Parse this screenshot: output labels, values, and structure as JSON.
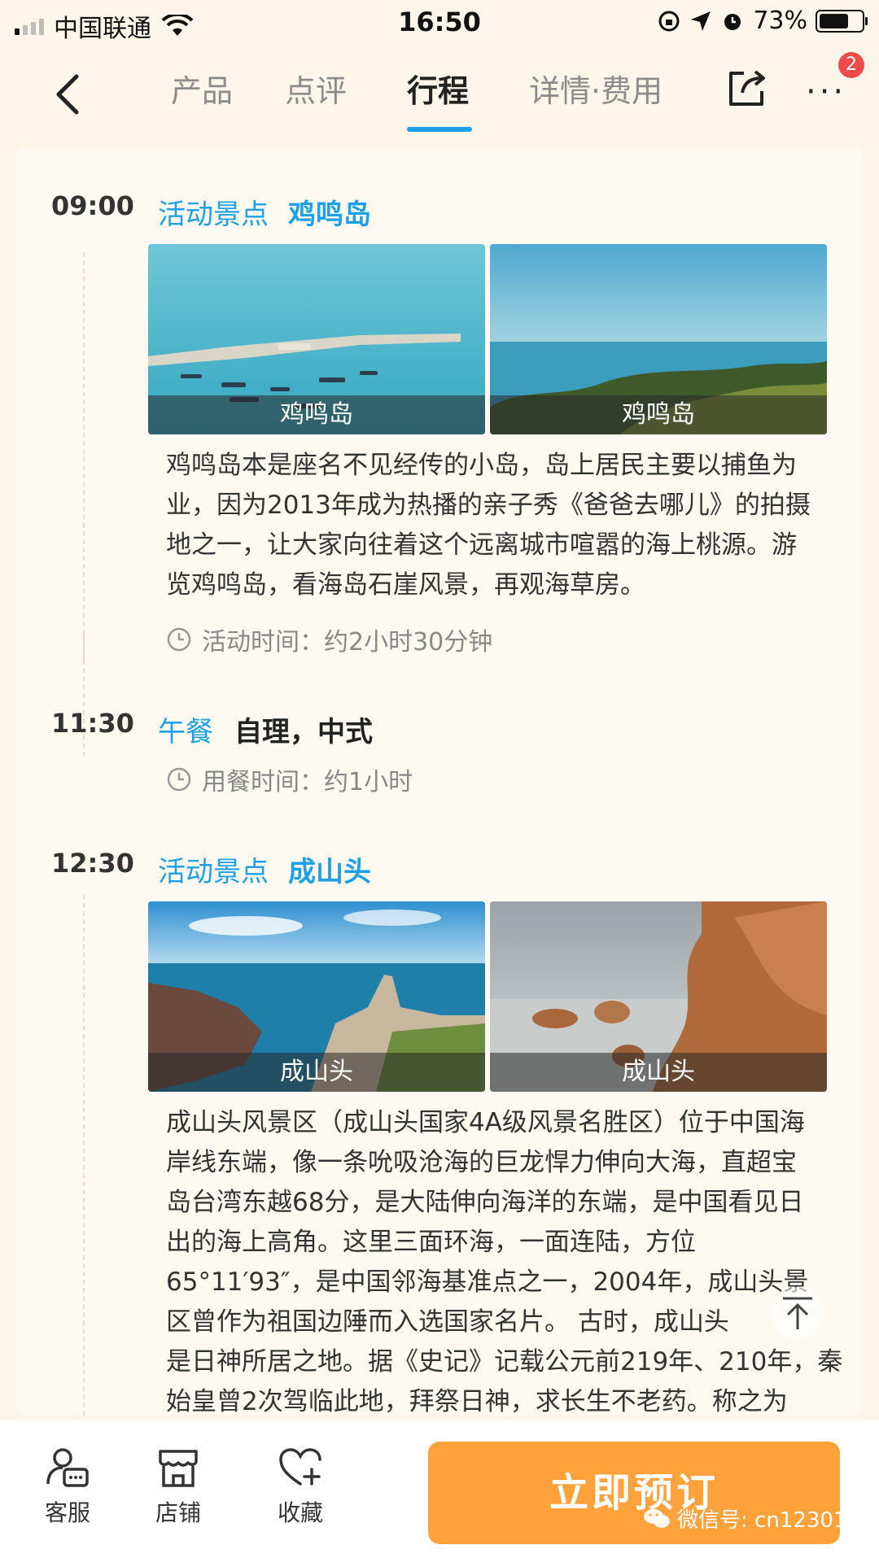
{
  "status_bar": {
    "carrier": "中国联通",
    "time": "16:50",
    "battery": "73%",
    "battery_level": 0.73
  },
  "nav": {
    "tabs": [
      {
        "label": "产品",
        "active": false
      },
      {
        "label": "点评",
        "active": false
      },
      {
        "label": "行程",
        "active": true
      },
      {
        "label": "详情·费用",
        "active": false
      }
    ],
    "badge_count": "2",
    "accent_color": "#1EA0E6"
  },
  "itinerary": {
    "item1": {
      "time": "09:00",
      "type": "活动景点",
      "title": "鸡鸣岛",
      "photos": [
        {
          "caption": "鸡鸣岛"
        },
        {
          "caption": "鸡鸣岛"
        }
      ],
      "description": [
        "鸡鸣岛本是座名不见经传的小岛，岛上居民主要以捕鱼为",
        "业，因为2013年成为热播的亲子秀《爸爸去哪儿》的拍摄",
        "地之一，让大家向往着这个远离城市喧嚣的海上桃源。游",
        "览鸡鸣岛，看海岛石崖风景，再观海草房。"
      ],
      "meta": "活动时间：约2小时30分钟"
    },
    "item2": {
      "time": "11:30",
      "type": "午餐",
      "title": "自理，中式",
      "meta": "用餐时间：约1小时"
    },
    "item3": {
      "time": "12:30",
      "type": "活动景点",
      "title": "成山头",
      "photos": [
        {
          "caption": "成山头"
        },
        {
          "caption": "成山头"
        }
      ],
      "description": [
        "成山头风景区（成山头国家4A级风景名胜区）位于中国海",
        "岸线东端，像一条吮吸沧海的巨龙悍力伸向大海，直超宝",
        "岛台湾东越68分，是大陆伸向海洋的东端，是中国看见日",
        "出的海上高角。这里三面环海，一面连陆，方位",
        "65°11′93″，是中国邻海基准点之一，2004年，成山头景",
        "区曾作为祖国边陲而入选国家名片。 古时，成山头",
        "是日神所居之地。据《史记》记载公元前219年、210年，秦",
        "始皇曾2次驾临此地，拜祭日神，求长生不老药。称之为"
      ]
    }
  },
  "bottom_bar": {
    "service": "客服",
    "shop": "店铺",
    "favorite": "收藏",
    "book_button": "立即预订",
    "book_color": "#FFA23C",
    "watermark": "微信号: cn12301"
  }
}
